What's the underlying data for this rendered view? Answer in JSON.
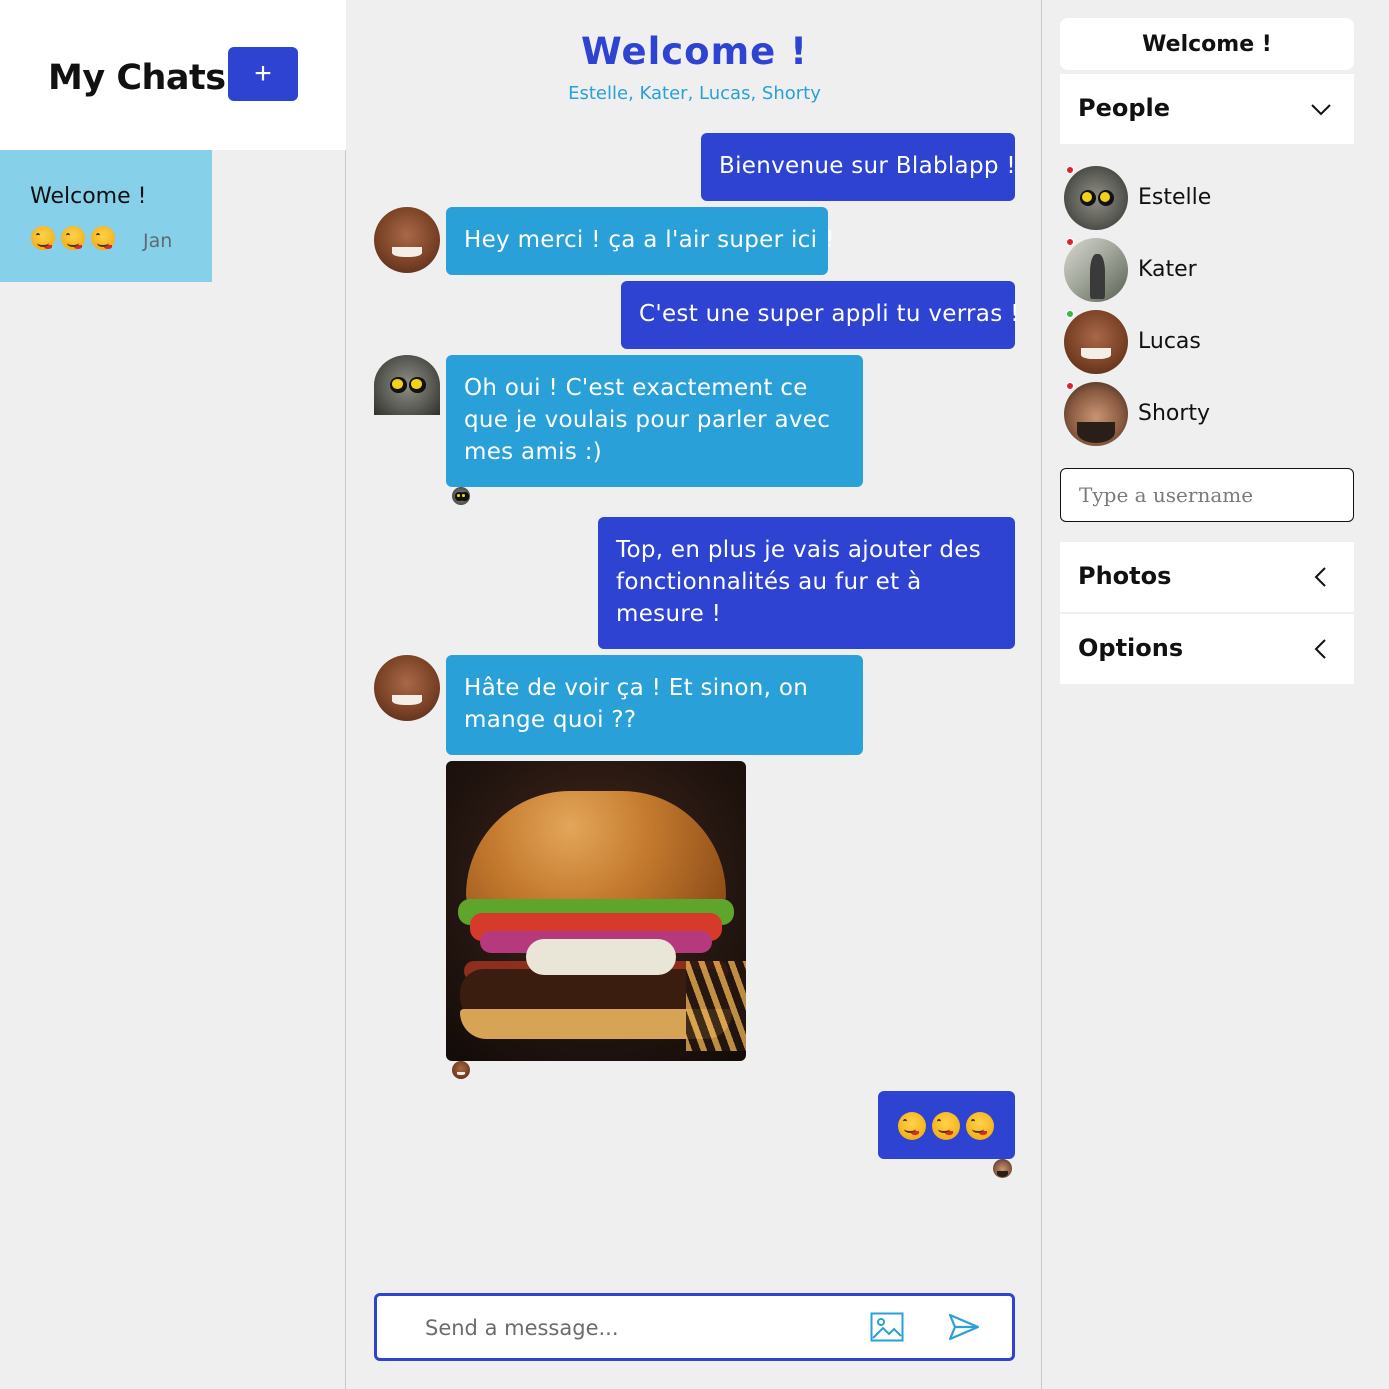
{
  "sidebar": {
    "title": "My Chats",
    "new_chat_label": "+",
    "chats": [
      {
        "title": "Welcome !",
        "preview_emojis": [
          "face-savoring-food",
          "face-savoring-food",
          "face-savoring-food"
        ],
        "date": "Jan"
      }
    ]
  },
  "chat": {
    "title": "Welcome !",
    "members": "Estelle, Kater, Lucas, Shorty",
    "messages": [
      {
        "sender": "me",
        "text": "Bienvenue sur Blablapp !"
      },
      {
        "sender": "Lucas",
        "text": "Hey merci ! ça a l'air super ici !"
      },
      {
        "sender": "me",
        "text": "C'est une super appli tu verras !"
      },
      {
        "sender": "Estelle",
        "text": "Oh oui ! C'est exactement ce que je voulais pour parler avec mes amis :)",
        "read_by": "Estelle"
      },
      {
        "sender": "me",
        "text": "Top, en plus je vais ajouter des fonctionnalités au fur et à mesure !"
      },
      {
        "sender": "Lucas",
        "text": "Hâte de voir ça ! Et sinon, on mange quoi ??"
      },
      {
        "sender": "Lucas",
        "image": "burger-photo",
        "read_by": "Lucas"
      },
      {
        "sender": "me",
        "emojis": [
          "face-savoring-food",
          "face-savoring-food",
          "face-savoring-food"
        ],
        "read_by": "Shorty"
      }
    ],
    "composer": {
      "placeholder": "Send a message...",
      "image_icon": "image-icon",
      "send_icon": "send-icon"
    }
  },
  "details": {
    "title": "Welcome !",
    "people_label": "People",
    "people": [
      {
        "name": "Estelle",
        "status": "offline"
      },
      {
        "name": "Kater",
        "status": "offline"
      },
      {
        "name": "Lucas",
        "status": "online"
      },
      {
        "name": "Shorty",
        "status": "offline"
      }
    ],
    "username_placeholder": "Type a username",
    "photos_label": "Photos",
    "options_label": "Options"
  },
  "colors": {
    "accent": "#2e43d2",
    "incoming": "#2aa0d8",
    "active_chat": "#87d0ea",
    "online": "#3ab54a",
    "offline": "#e0202a"
  }
}
